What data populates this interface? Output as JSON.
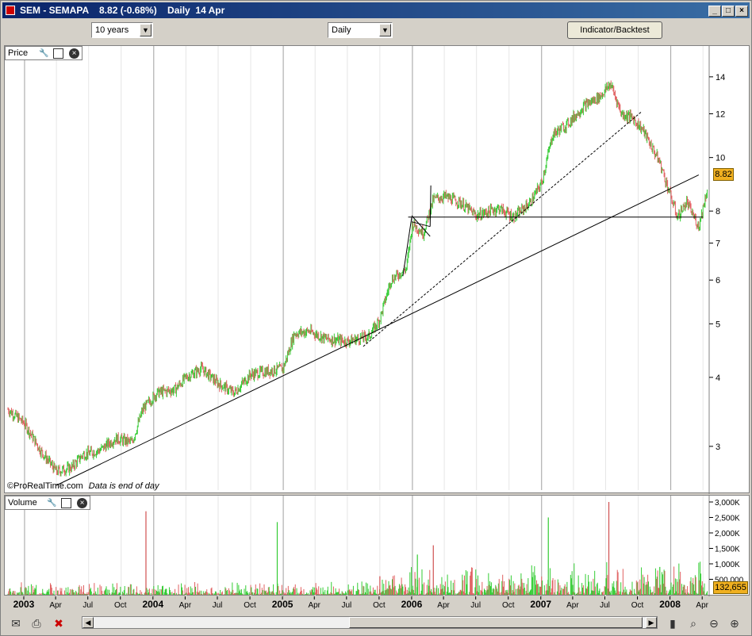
{
  "window": {
    "title": "SEM - SEMAPA    8.82 (-0.68%)    Daily  14 Apr",
    "minimize": "_",
    "maximize": "□",
    "close": "×"
  },
  "toolbar": {
    "period_value": "10 years",
    "interval_value": "Daily",
    "indicator_button": "Indicator/Backtest"
  },
  "price_panel": {
    "label": "Price",
    "current_price": "8.82",
    "watermark": "©ProRealTime.com",
    "data_note": "Data is end of day"
  },
  "volume_panel": {
    "label": "Volume",
    "current_volume": "132,655"
  },
  "chart_data": [
    {
      "type": "candlestick",
      "title": "SEM - SEMAPA",
      "y_scale": "log",
      "ylim": [
        2.5,
        15
      ],
      "y_ticks": [
        3,
        4,
        5,
        6,
        7,
        8,
        10,
        12,
        14
      ],
      "x_labels": [
        "2003",
        "Apr",
        "Jul",
        "Oct",
        "2004",
        "Apr",
        "Jul",
        "Oct",
        "2005",
        "Apr",
        "Jul",
        "Oct",
        "2006",
        "Apr",
        "Jul",
        "Oct",
        "2007",
        "Apr",
        "Jul",
        "Oct",
        "2008",
        "Apr"
      ],
      "x_range": [
        "2002-11-15",
        "2008-04-14"
      ],
      "colors": {
        "up": "#33cc33",
        "down": "#e06060"
      },
      "series": [
        {
          "values": [
            [
              "2002-11-15",
              3.5
            ],
            [
              "2003-01-01",
              3.3
            ],
            [
              "2003-02-15",
              2.95
            ],
            [
              "2003-04-01",
              2.7
            ],
            [
              "2003-05-15",
              2.75
            ],
            [
              "2003-06-15",
              2.9
            ],
            [
              "2003-08-01",
              2.95
            ],
            [
              "2003-09-15",
              3.1
            ],
            [
              "2003-11-01",
              3.05
            ],
            [
              "2003-12-01",
              3.5
            ],
            [
              "2004-01-10",
              3.75
            ],
            [
              "2004-03-01",
              3.8
            ],
            [
              "2004-04-01",
              4.0
            ],
            [
              "2004-05-15",
              4.15
            ],
            [
              "2004-07-01",
              3.9
            ],
            [
              "2004-08-15",
              3.75
            ],
            [
              "2004-10-01",
              4.05
            ],
            [
              "2004-11-15",
              4.1
            ],
            [
              "2005-01-01",
              4.15
            ],
            [
              "2005-02-01",
              4.8
            ],
            [
              "2005-03-15",
              4.85
            ],
            [
              "2005-05-01",
              4.7
            ],
            [
              "2005-07-01",
              4.65
            ],
            [
              "2005-09-01",
              4.75
            ],
            [
              "2005-10-01",
              5.1
            ],
            [
              "2005-11-01",
              6.0
            ],
            [
              "2005-12-15",
              6.3
            ],
            [
              "2006-01-01",
              7.6
            ],
            [
              "2006-02-01",
              7.3
            ],
            [
              "2006-03-01",
              8.4
            ],
            [
              "2006-04-01",
              8.5
            ],
            [
              "2006-05-15",
              8.3
            ],
            [
              "2006-07-01",
              7.85
            ],
            [
              "2006-09-01",
              8.1
            ],
            [
              "2006-10-15",
              7.8
            ],
            [
              "2006-12-01",
              8.3
            ],
            [
              "2007-01-01",
              9.0
            ],
            [
              "2007-02-01",
              11.0
            ],
            [
              "2007-03-15",
              11.5
            ],
            [
              "2007-05-01",
              12.4
            ],
            [
              "2007-06-15",
              12.9
            ],
            [
              "2007-07-15",
              13.6
            ],
            [
              "2007-08-15",
              12.0
            ],
            [
              "2007-09-15",
              11.8
            ],
            [
              "2007-10-15",
              11.2
            ],
            [
              "2007-12-01",
              9.8
            ],
            [
              "2008-01-01",
              8.5
            ],
            [
              "2008-01-20",
              7.8
            ],
            [
              "2008-02-15",
              8.3
            ],
            [
              "2008-03-20",
              7.5
            ],
            [
              "2008-04-14",
              8.82
            ]
          ]
        }
      ]
    },
    {
      "type": "bar",
      "title": "Volume",
      "ylim": [
        0,
        3000000
      ],
      "y_ticks": [
        "500,000",
        "1,000K",
        "1,500K",
        "2,000K",
        "2,500K",
        "3,000K"
      ],
      "spikes": [
        [
          "2003-12-10",
          2700000
        ],
        [
          "2004-12-15",
          2350000
        ],
        [
          "2005-10-01",
          600000
        ],
        [
          "2006-01-15",
          1300000
        ],
        [
          "2006-03-01",
          1600000
        ],
        [
          "2007-01-20",
          2500000
        ],
        [
          "2007-07-10",
          3000000
        ],
        [
          "2007-12-01",
          900000
        ]
      ],
      "baseline_volume": 150000
    }
  ]
}
